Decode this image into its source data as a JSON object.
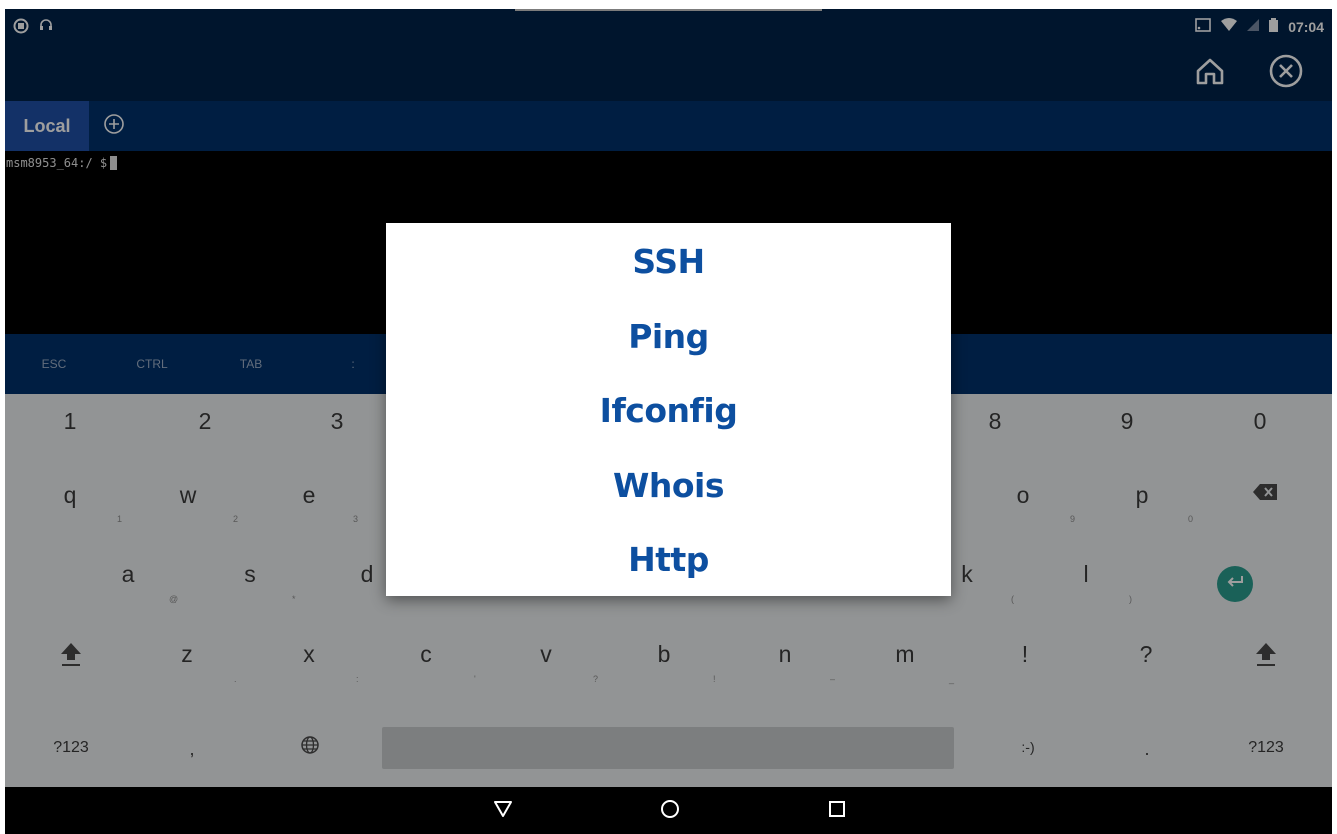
{
  "status_bar": {
    "time": "07:04"
  },
  "tabs": [
    {
      "label": "Local"
    }
  ],
  "terminal": {
    "prompt": "msm8953_64:/ $"
  },
  "extra_keys": [
    "ESC",
    "CTRL",
    "TAB",
    ":"
  ],
  "dialog": {
    "items": [
      "SSH",
      "Ping",
      "Ifconfig",
      "Whois",
      "Http"
    ]
  },
  "keyboard": {
    "number_row": [
      "1",
      "2",
      "3",
      "",
      "",
      "",
      "",
      "8",
      "9",
      "0"
    ],
    "row_q": {
      "keys": [
        "q",
        "w",
        "e",
        "o",
        "p"
      ],
      "hints": [
        "1",
        "2",
        "3",
        "9",
        "0"
      ]
    },
    "row_a": {
      "keys": [
        "a",
        "s",
        "d",
        "k",
        "l"
      ],
      "hints": [
        "@",
        "*",
        "(",
        ")"
      ]
    },
    "row_z": {
      "keys": [
        "z",
        "x",
        "c",
        "v",
        "b",
        "n",
        "m",
        "!",
        "?"
      ],
      "hints": [
        ".",
        ":",
        "'",
        "?",
        "!",
        "–",
        "_"
      ]
    },
    "bottom_row": {
      "symbols_label": "?123",
      "comma": ",",
      "emoticon": ":-)",
      "period": ".",
      "symbols_label_right": "?123"
    }
  },
  "colors": {
    "app_bar": "#00224a",
    "tab_bar": "#00316b",
    "tab_active": "#1f4fa6",
    "dialog_text": "#0d4fa0",
    "enter_key": "#2a9d8f"
  }
}
